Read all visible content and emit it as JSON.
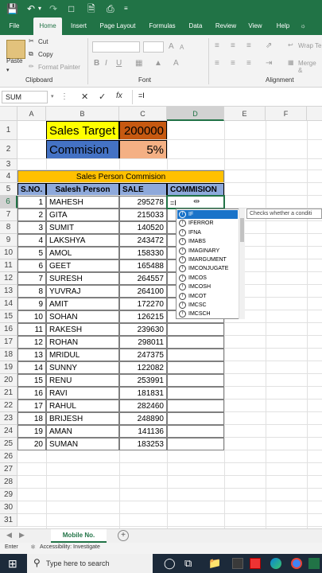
{
  "quick_access": {
    "save_icon": "save-icon",
    "undo_icon": "undo-icon",
    "redo_icon": "redo-icon"
  },
  "tabs": [
    "File",
    "Home",
    "Insert",
    "Page Layout",
    "Formulas",
    "Data",
    "Review",
    "View",
    "Help",
    "Wrap Te"
  ],
  "ribbon": {
    "paste_label": "Paste",
    "cut_label": "Cut",
    "copy_label": "Copy",
    "format_painter_label": "Format Painter",
    "clipboard_group": "Clipboard",
    "font_group": "Font",
    "alignment_group": "Alignment",
    "merge_label": "Merge &",
    "bold": "B",
    "italic": "I",
    "underline": "U",
    "font_grow": "A",
    "font_shrink": "A"
  },
  "formula_bar": {
    "name_box": "SUM",
    "cancel": "✕",
    "enter": "✓",
    "fx": "fx",
    "formula": "=I"
  },
  "columns": [
    "A",
    "B",
    "C",
    "D",
    "E",
    "F"
  ],
  "rows": [
    "1",
    "2",
    "3",
    "4",
    "5",
    "6",
    "7",
    "8",
    "9",
    "10",
    "11",
    "12",
    "13",
    "14",
    "15",
    "16",
    "17",
    "18",
    "19",
    "20",
    "21",
    "22",
    "23",
    "24",
    "25",
    "26",
    "27",
    "28",
    "29",
    "30",
    "31"
  ],
  "sheet": {
    "target_label": "Sales Target",
    "target_value": "200000",
    "commission_label": "Commision",
    "commission_value": "5%",
    "table_title": "Sales Person Commision",
    "headers": {
      "sno": "S.NO.",
      "person": "Salesh Person",
      "sale": "SALE",
      "commission": "COMMISION"
    },
    "active_cell_text": "=I",
    "records": [
      {
        "sno": "1",
        "name": "MAHESH",
        "sale": "295278"
      },
      {
        "sno": "2",
        "name": "GITA",
        "sale": "215033"
      },
      {
        "sno": "3",
        "name": "SUMIT",
        "sale": "140520"
      },
      {
        "sno": "4",
        "name": "LAKSHYA",
        "sale": "243472"
      },
      {
        "sno": "5",
        "name": "AMOL",
        "sale": "158330"
      },
      {
        "sno": "6",
        "name": "GEET",
        "sale": "165488"
      },
      {
        "sno": "7",
        "name": "SURESH",
        "sale": "264557"
      },
      {
        "sno": "8",
        "name": "YUVRAJ",
        "sale": "264100"
      },
      {
        "sno": "9",
        "name": "AMIT",
        "sale": "172270"
      },
      {
        "sno": "10",
        "name": "SOHAN",
        "sale": "126215"
      },
      {
        "sno": "11",
        "name": "RAKESH",
        "sale": "239630"
      },
      {
        "sno": "12",
        "name": "ROHAN",
        "sale": "298011"
      },
      {
        "sno": "13",
        "name": "MRIDUL",
        "sale": "247375"
      },
      {
        "sno": "14",
        "name": "SUNNY",
        "sale": "122082"
      },
      {
        "sno": "15",
        "name": "RENU",
        "sale": "253991"
      },
      {
        "sno": "16",
        "name": "RAVI",
        "sale": "181831"
      },
      {
        "sno": "17",
        "name": "RAHUL",
        "sale": "282460"
      },
      {
        "sno": "18",
        "name": "BRIJESH",
        "sale": "248890"
      },
      {
        "sno": "19",
        "name": "AMAN",
        "sale": "141136"
      },
      {
        "sno": "20",
        "name": "SUMAN",
        "sale": "183253"
      }
    ]
  },
  "autocomplete": {
    "items": [
      "IF",
      "IFERROR",
      "IFNA",
      "IMABS",
      "IMAGINARY",
      "IMARGUMENT",
      "IMCONJUGATE",
      "IMCOS",
      "IMCOSH",
      "IMCOT",
      "IMCSC",
      "IMCSCH"
    ],
    "tooltip": "Checks whether a conditi"
  },
  "sheet_tabs": {
    "active": "Mobile No.",
    "add": "+"
  },
  "status": {
    "mode": "Enter",
    "accessibility": "Accessibility: Investigate"
  },
  "taskbar": {
    "search_placeholder": "Type here to search"
  },
  "colors": {
    "excel_green": "#217346",
    "target_label_bg": "#ffff00",
    "target_value_bg": "#c65911",
    "commission_label_bg": "#4472c4",
    "commission_value_bg": "#f4b084",
    "title_bg": "#ffc000",
    "header_bg": "#8ea9db",
    "selection_blue": "#1a73c9"
  }
}
